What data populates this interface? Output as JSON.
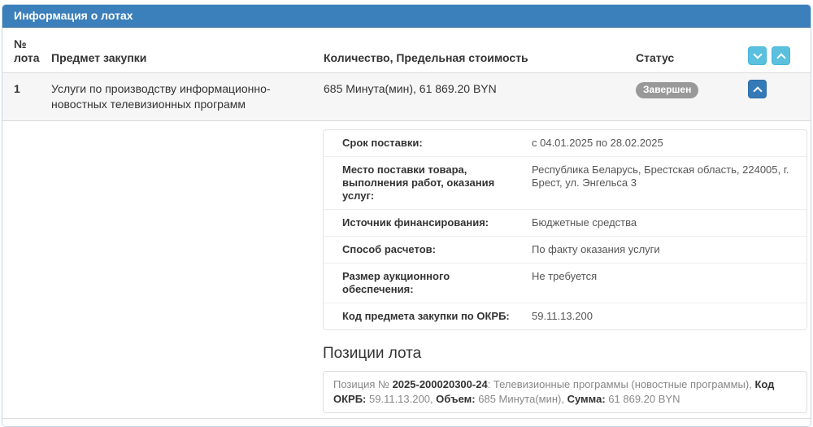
{
  "colors": {
    "header_bg": "#3b7fbb",
    "header_border": "#31699c",
    "panel_border": "#c3d6e8",
    "sort_button_bg": "#5bc0de",
    "collapse_button_bg": "#337ab7",
    "status_badge_bg": "#999999",
    "row_stripe_bg": "#f6f6f6"
  },
  "panel": {
    "title": "Информация о лотах"
  },
  "table": {
    "columns": {
      "num": "№ лота",
      "subject": "Предмет закупки",
      "quantity": "Количество, Предельная стоимость",
      "status": "Статус"
    },
    "rows": [
      {
        "num": "1",
        "subject": "Услуги по производству информационно-новостных телевизионных программ",
        "quantity": "685 Минута(мин), 61 869.20 BYN",
        "status": "Завершен"
      }
    ]
  },
  "details": {
    "rows": [
      {
        "label": "Срок поставки:",
        "value": "с 04.01.2025 по 28.02.2025"
      },
      {
        "label": "Место поставки товара, выполнения работ, оказания услуг:",
        "value": "Республика Беларусь, Брестская область, 224005, г. Брест, ул. Энгельса 3"
      },
      {
        "label": "Источник финансирования:",
        "value": "Бюджетные средства"
      },
      {
        "label": "Способ расчетов:",
        "value": "По факту оказания услуги"
      },
      {
        "label": "Размер аукционного обеспечения:",
        "value": "Не требуется"
      },
      {
        "label": "Код предмета закупки по ОКРБ:",
        "value": "59.11.13.200"
      }
    ],
    "positions_heading": "Позиции лота",
    "position": {
      "prefix": "Позиция № ",
      "number": "2025-200020300-24",
      "desc": ": Телевизионные программы (новостные программы), ",
      "okrb_label": "Код ОКРБ:",
      "okrb_value": " 59.11.13.200, ",
      "volume_label": "Объем:",
      "volume_value": " 685 Минута(мин), ",
      "sum_label": "Сумма:",
      "sum_value": " 61 869.20 BYN"
    }
  },
  "icons": {
    "sort_descending": "chevron-down",
    "sort_ascending": "chevron-up",
    "collapse_row": "chevron-up"
  }
}
